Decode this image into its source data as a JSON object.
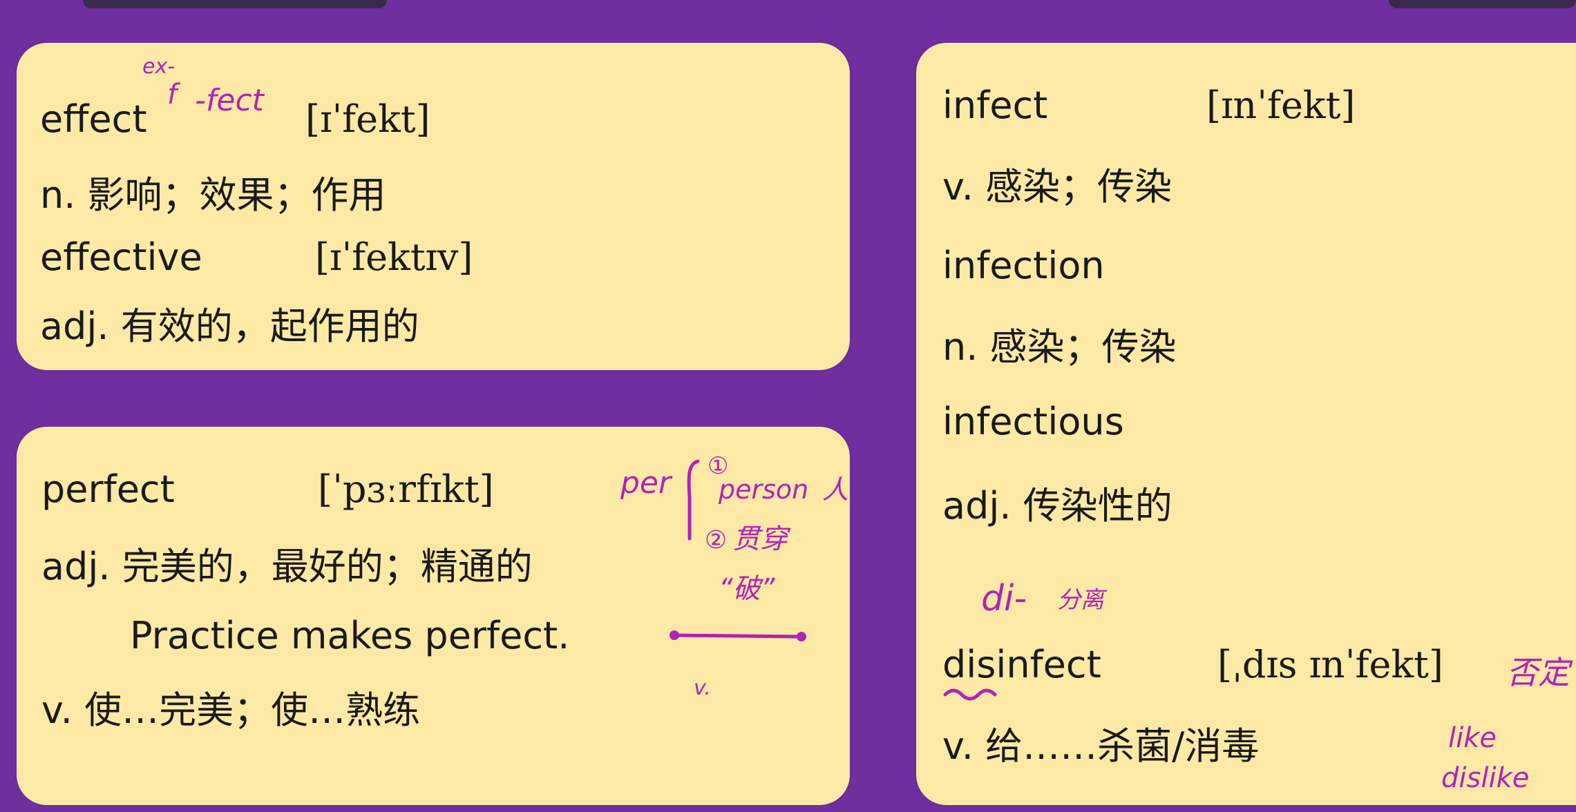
{
  "cards": {
    "effect": {
      "word": "effect",
      "phonetic": "[ɪˈfekt]",
      "meaning": "n. 影响；效果；作用",
      "derived_word": "effective",
      "derived_phonetic": "[ɪˈfektɪv]",
      "derived_meaning": "adj. 有效的，起作用的"
    },
    "perfect": {
      "word": "perfect",
      "phonetic": "[ˈpɜːrfɪkt]",
      "meaning_adj": "adj. 完美的，最好的；精通的",
      "example": "Practice makes perfect.",
      "meaning_v": "v. 使…完美；使…熟练"
    },
    "infect": {
      "word": "infect",
      "phonetic": "[ɪnˈfekt]",
      "meaning": "v. 感染；传染",
      "word2": "infection",
      "meaning2": "n. 感染；传染",
      "word3": "infectious",
      "meaning3": "adj. 传染性的",
      "word4": "disinfect",
      "phonetic4": "[ˌdɪs ɪnˈfekt]",
      "meaning4": "v. 给……杀菌/消毒"
    }
  },
  "annotations": {
    "effect_prefix": "ex-",
    "effect_root_f": "f",
    "effect_root": "-fect",
    "per_label": "per",
    "per_item1_marker": "①",
    "per_item1_word": "person",
    "per_item1_meaning": "人",
    "per_item2_marker": "②",
    "per_item2_meaning": "贯穿",
    "per_item2_quote": "“破”",
    "per_v": "v.",
    "di_prefix": "di-",
    "di_meaning": "分离",
    "fouding": "否定",
    "like": "like",
    "dislike": "dislike"
  },
  "colors": {
    "background": "#6f2f9e",
    "card": "#fde9a6",
    "ink": "#b023b8",
    "text": "#1a1a1a"
  }
}
